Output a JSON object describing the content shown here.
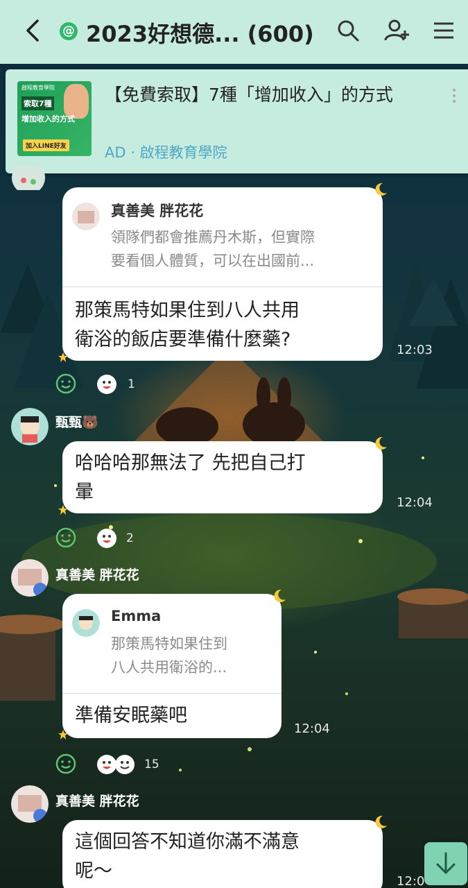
{
  "header": {
    "title": "2023好想德... (600)",
    "at_label": "@",
    "icons": [
      "back-icon",
      "search-icon",
      "add-friend-icon",
      "menu-icon"
    ]
  },
  "ad": {
    "title": "【免費索取】7種「增加收入」的方式",
    "subtitle": "AD · 啟程教育學院",
    "thumb_top": "啟程教育學院",
    "thumb_line1": "索取7種",
    "thumb_line2": "增加收入的方式",
    "thumb_cta": "加入LINE好友"
  },
  "messages": [
    {
      "reply_name": "真善美 胖花花",
      "reply_line1": "領隊們都會推薦丹木斯，但實際",
      "reply_line2": "要看個人體質，可以在出國前...",
      "line1": "那策馬特如果住到八人共用",
      "line2": "衛浴的飯店要準備什麼藥?",
      "time": "12:03",
      "reaction_count": "1"
    },
    {
      "sender": "甄甄🐻",
      "line1": "哈哈哈那無法了 先把自己打",
      "line2": "暈",
      "time": "12:04",
      "reaction_count": "2"
    },
    {
      "sender": "真善美 胖花花",
      "reply_name": "Emma",
      "reply_line1": "那策馬特如果住到",
      "reply_line2": "八人共用衛浴的...",
      "line1": "準備安眠藥吧",
      "time": "12:04",
      "reaction_count": "15"
    },
    {
      "sender": "真善美 胖花花",
      "line1": "這個回答不知道你滿不滿意",
      "line2": "呢～",
      "time": "12:0"
    }
  ],
  "colors": {
    "header_bg": "#c6ecdf",
    "ad_link": "#4fa7c5",
    "accent_green": "#2fb76a",
    "moon": "#f6c83a"
  }
}
